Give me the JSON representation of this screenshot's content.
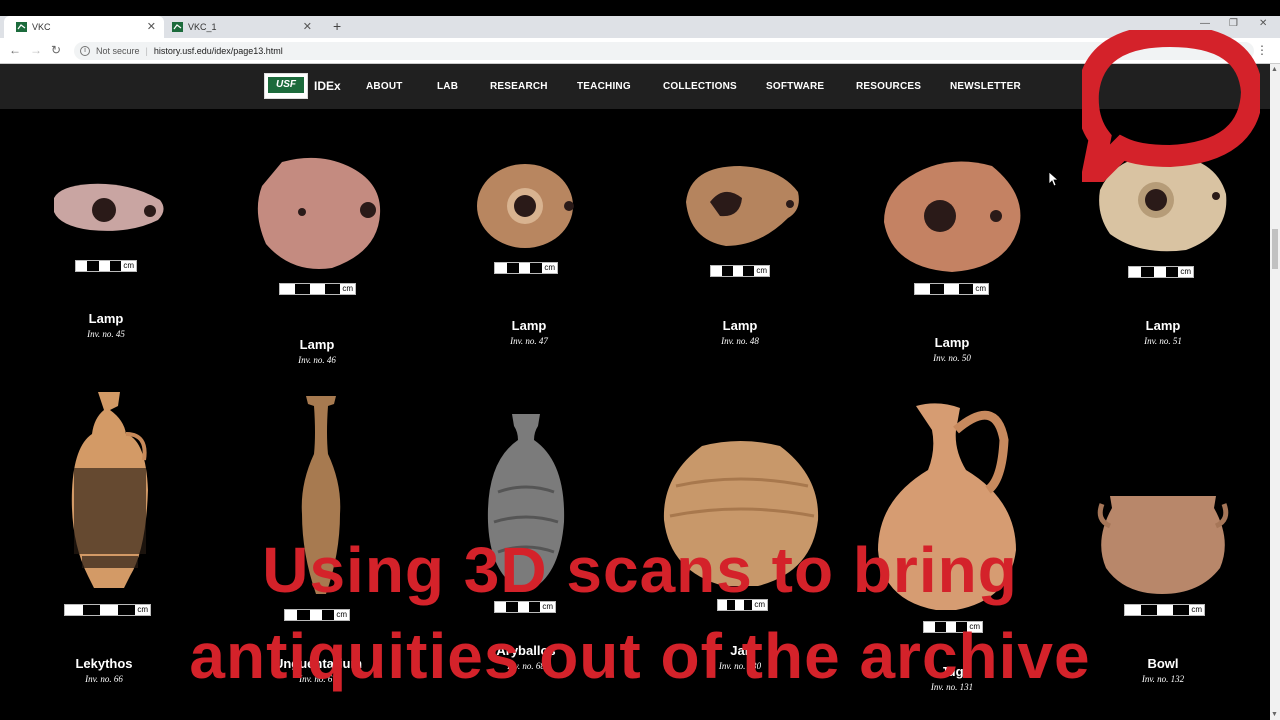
{
  "browser": {
    "tabs": [
      {
        "label": "VKC",
        "active": true
      },
      {
        "label": "VKC_1",
        "active": false
      }
    ],
    "security": "Not secure",
    "url": "history.usf.edu/idex/page13.html"
  },
  "site": {
    "brand": "IDEx",
    "logo_text": "USF",
    "nav": [
      "ABOUT",
      "LAB",
      "RESEARCH",
      "TEACHING",
      "COLLECTIONS",
      "SOFTWARE",
      "RESOURCES",
      "NEWSLETTER"
    ]
  },
  "artifacts_row1": [
    {
      "title": "Lamp",
      "inv": "Inv. no. 45"
    },
    {
      "title": "Lamp",
      "inv": "Inv. no. 46"
    },
    {
      "title": "Lamp",
      "inv": "Inv. no. 47"
    },
    {
      "title": "Lamp",
      "inv": "Inv. no. 48"
    },
    {
      "title": "Lamp",
      "inv": "Inv. no. 50"
    },
    {
      "title": "Lamp",
      "inv": "Inv. no. 51"
    }
  ],
  "artifacts_row2": [
    {
      "title": "Lekythos",
      "inv": "Inv. no. 66"
    },
    {
      "title": "Unguentarium",
      "inv": "Inv. no. 67"
    },
    {
      "title": "Aryballos",
      "inv": "Inv. no. 68"
    },
    {
      "title": "Jar",
      "inv": "Inv. no. 130"
    },
    {
      "title": "Jug",
      "inv": "Inv. no. 131"
    },
    {
      "title": "Bowl",
      "inv": "Inv. no. 132"
    }
  ],
  "scale_unit": "cm",
  "overlay": {
    "line1": "Using 3D scans to bring",
    "line2": "antiquities out of the archive",
    "color": "#d4222a"
  },
  "colors": {
    "nav_bg": "#202020",
    "accent": "#d4222a",
    "usf_green": "#1c6b3c"
  }
}
